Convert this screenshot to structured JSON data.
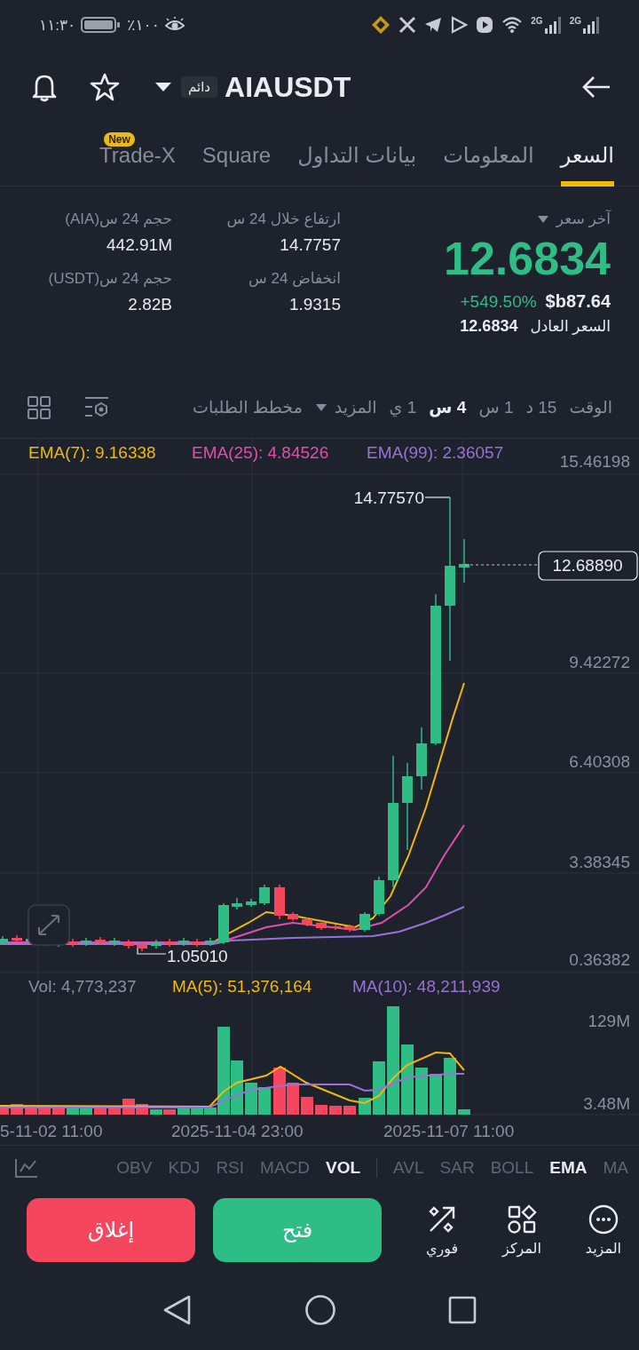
{
  "status_bar": {
    "time": "١١:٣٠",
    "battery_percent": "٪١٠٠",
    "network_labels": [
      "2G",
      "2G"
    ]
  },
  "header": {
    "symbol": "AIAUSDT",
    "contract_tag": "دائم"
  },
  "tabs": [
    {
      "label": "السعر",
      "selected": true
    },
    {
      "label": "المعلومات",
      "selected": false
    },
    {
      "label": "بيانات التداول",
      "selected": false
    },
    {
      "label": "Square",
      "selected": false
    },
    {
      "label": "Trade-X",
      "selected": false,
      "badge": "New"
    }
  ],
  "price": {
    "label": "آخر سعر",
    "last": "12.6834",
    "fiat": "$b87.64",
    "change": "+549.50%",
    "fair_label": "السعر العادل",
    "fair": "12.6834"
  },
  "stats": [
    {
      "label": "ارتفاع خلال 24 س",
      "value": "14.7757"
    },
    {
      "label": "حجم 24 س(AIA)",
      "value": "442.91M"
    },
    {
      "label": "انخفاض 24 س",
      "value": "1.9315"
    },
    {
      "label": "حجم 24 س(USDT)",
      "value": "2.82B"
    }
  ],
  "toolbar": {
    "time_label": "الوقت",
    "intervals": [
      {
        "label": "15 د",
        "selected": false
      },
      {
        "label": "1 س",
        "selected": false
      },
      {
        "label": "4 س",
        "selected": true
      },
      {
        "label": "1 ي",
        "selected": false
      }
    ],
    "more": "المزيد",
    "depth_chart": "مخطط الطلبات"
  },
  "chart": {
    "legend": [
      {
        "text": "EMA(99): 2.36057",
        "color": "#9a72d6"
      },
      {
        "text": "EMA(25): 4.84526",
        "color": "#e04fae"
      },
      {
        "text": "EMA(7): 9.16338",
        "color": "#f0b90b"
      }
    ],
    "y_labels": [
      "15.46198",
      "9.42272",
      "6.40308",
      "3.38345",
      "0.36382"
    ],
    "high_label": "14.77570",
    "low_label": "1.05010",
    "current_price": "12.68890"
  },
  "volume": {
    "legend": [
      {
        "text": "MA(10): 48,211,939",
        "color": "#9a72d6"
      },
      {
        "text": "MA(5): 51,376,164",
        "color": "#f0b90b"
      },
      {
        "text": "Vol: 4,773,237",
        "color": "#8a919e"
      }
    ],
    "y_labels": [
      "129M",
      "3.48M"
    ]
  },
  "x_labels": [
    "2025-11-07 11:00",
    "2025-11-04 23:00",
    "5-11-02 11:00"
  ],
  "indicators": [
    {
      "label": "MA",
      "selected": false
    },
    {
      "label": "EMA",
      "selected": true
    },
    {
      "label": "BOLL",
      "selected": false
    },
    {
      "label": "SAR",
      "selected": false
    },
    {
      "label": "AVL",
      "selected": false
    },
    {
      "label": "VOL",
      "selected": true
    },
    {
      "label": "MACD",
      "selected": false
    },
    {
      "label": "RSI",
      "selected": false
    },
    {
      "label": "KDJ",
      "selected": false
    },
    {
      "label": "OBV",
      "selected": false
    }
  ],
  "actions": [
    {
      "label": "المزيد",
      "kind": "more"
    },
    {
      "label": "المركز",
      "kind": "positions"
    },
    {
      "label": "فوري",
      "kind": "spot"
    }
  ],
  "buttons": [
    {
      "label": "فتح",
      "kind": "open"
    },
    {
      "label": "إغلاق",
      "kind": "close"
    }
  ]
}
